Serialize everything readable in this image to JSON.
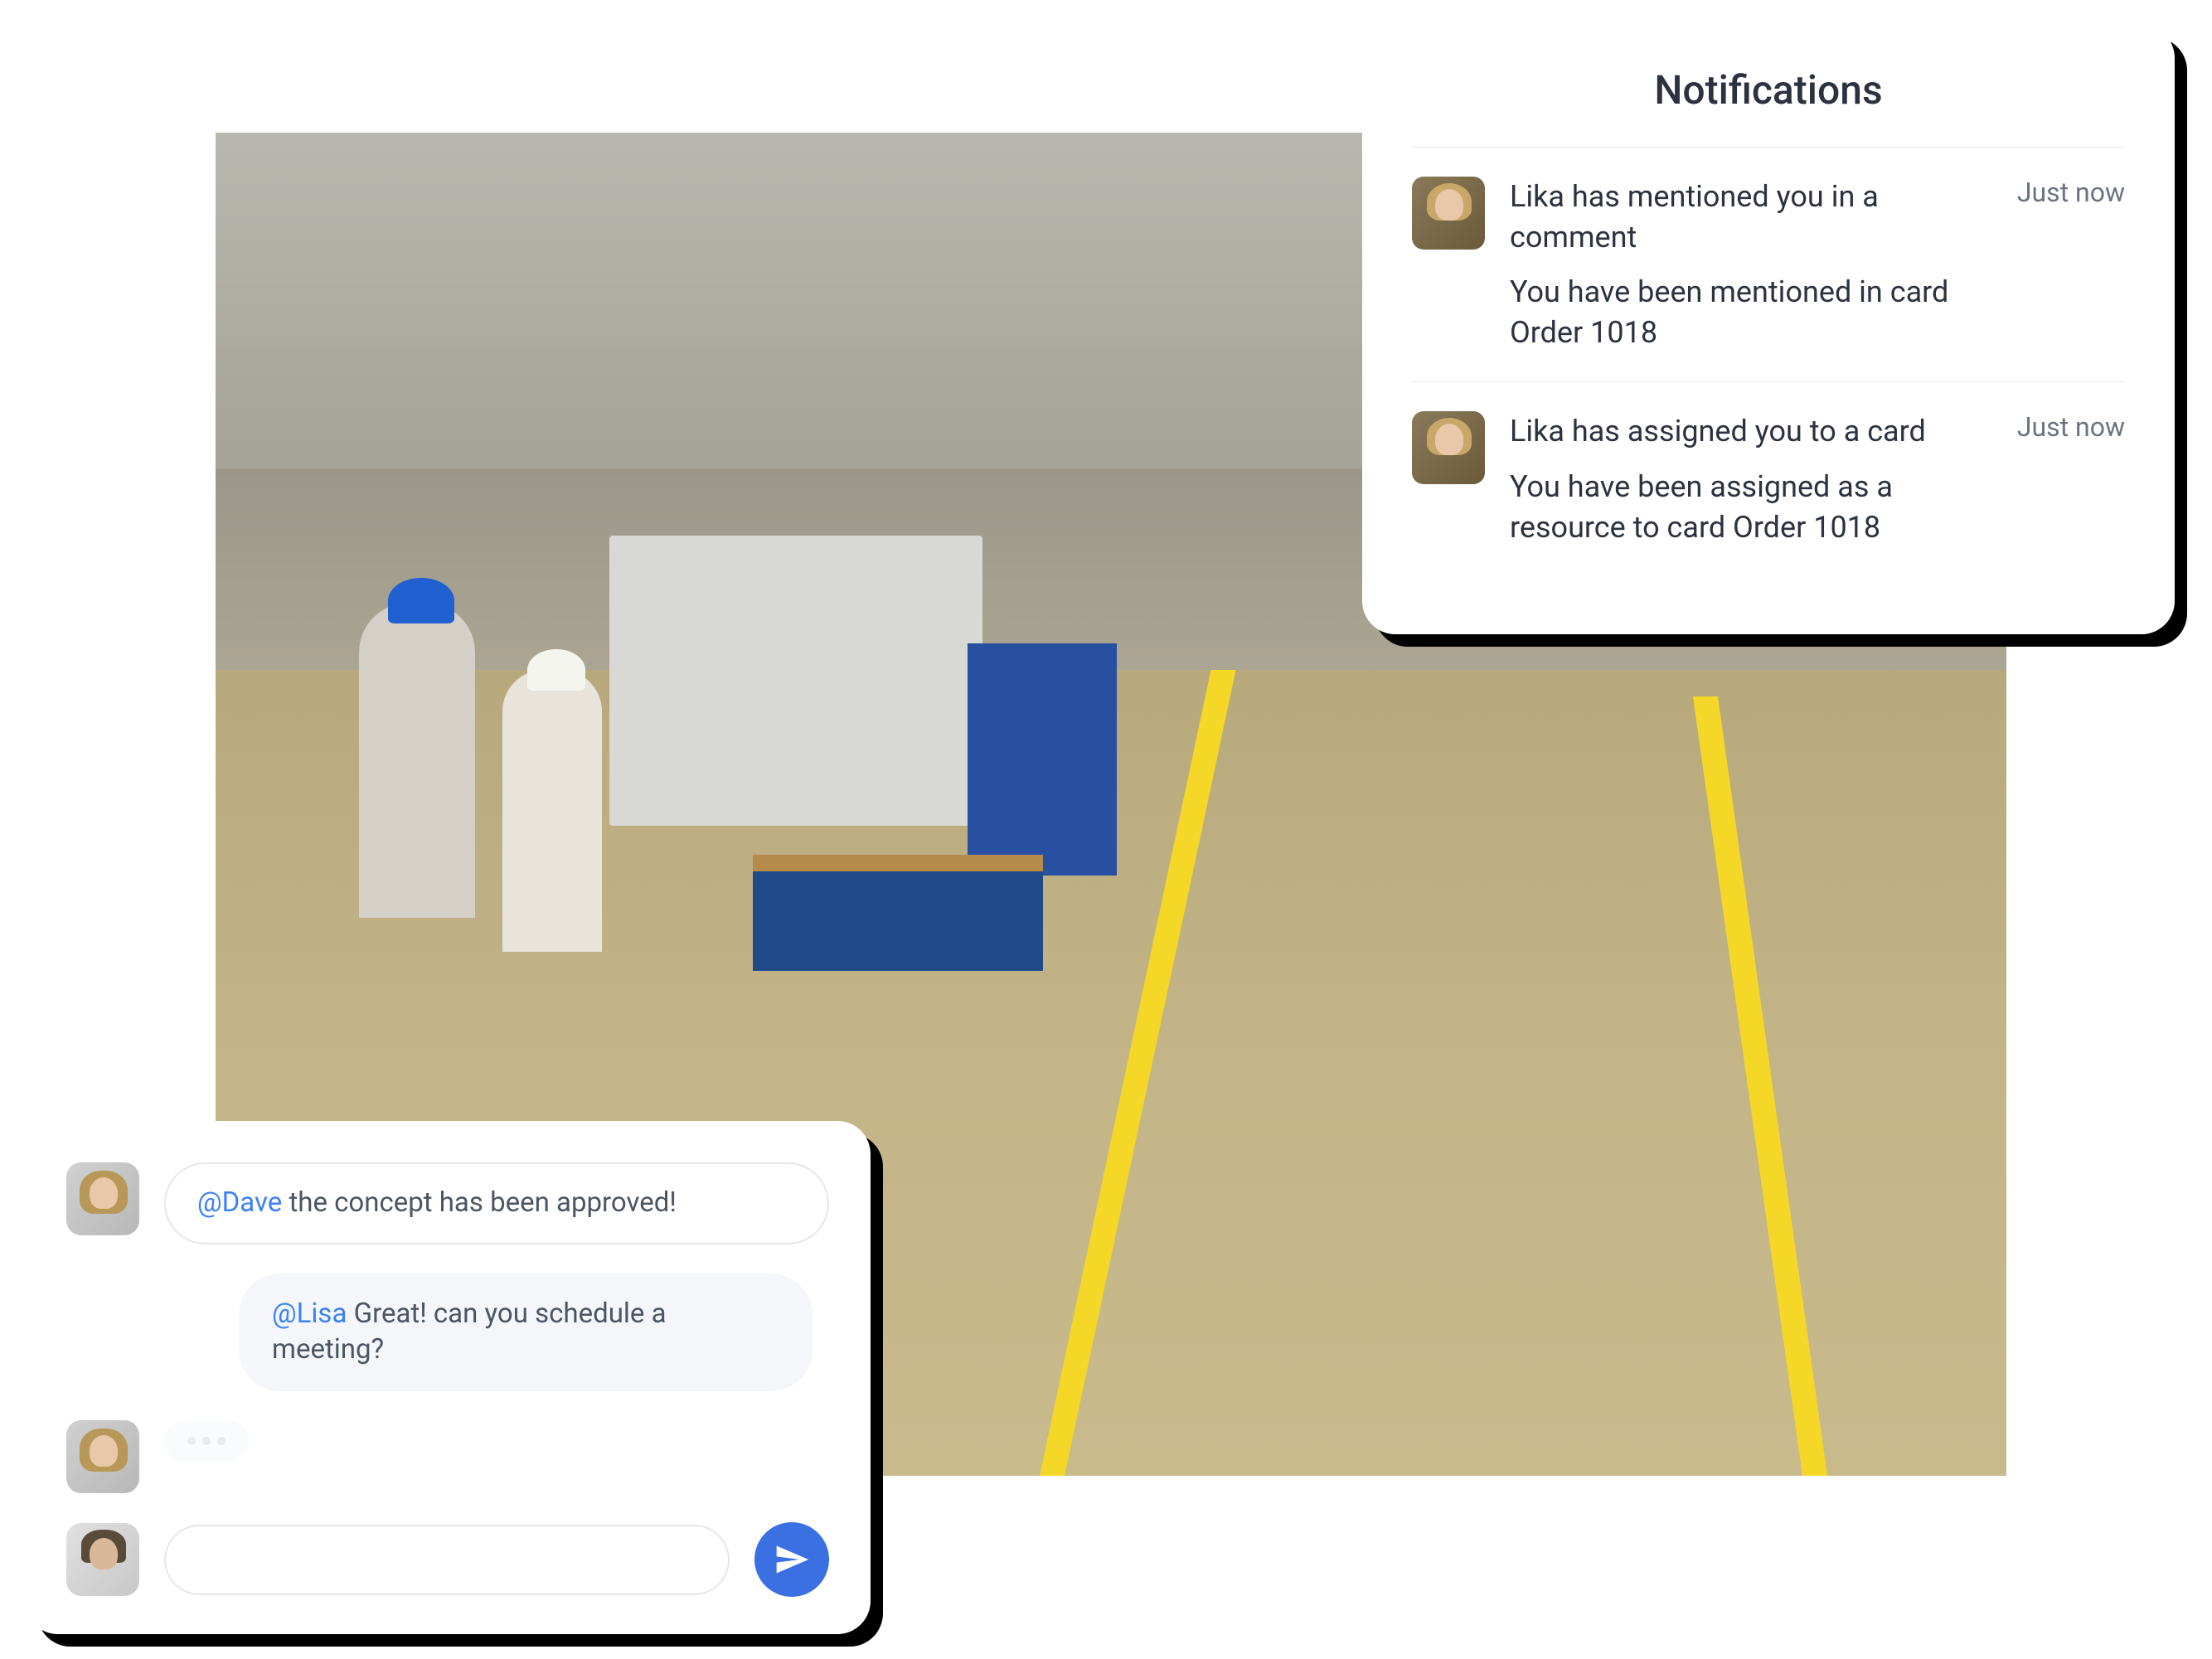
{
  "notifications": {
    "title": "Notifications",
    "items": [
      {
        "title": "Lika has mentioned you in a comment",
        "time": "Just now",
        "body": "You have been mentioned in card Order 1018"
      },
      {
        "title": "Lika has assigned you to a card",
        "time": "Just now",
        "body": "You have been assigned as a resource to card Order 1018"
      }
    ]
  },
  "chat": {
    "messages": [
      {
        "mention": "@Dave",
        "text": " the concept has been approved!"
      },
      {
        "mention": "@Lisa",
        "text": " Great! can you schedule a meeting?"
      }
    ]
  }
}
